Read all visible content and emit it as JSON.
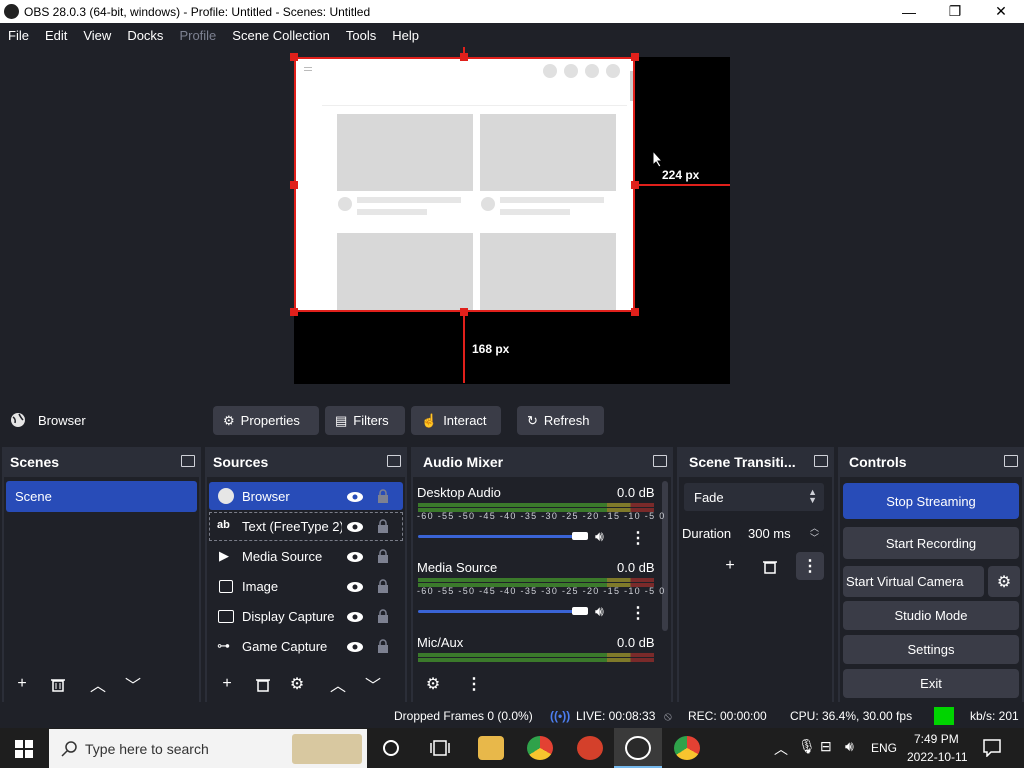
{
  "window": {
    "title": "OBS 28.0.3 (64-bit, windows) - Profile: Untitled - Scenes: Untitled",
    "minimize_glyph": "—",
    "maximize_glyph": "❐",
    "close_glyph": "✕"
  },
  "menu": [
    "File",
    "Edit",
    "View",
    "Docks",
    "Profile",
    "Scene Collection",
    "Tools",
    "Help"
  ],
  "preview": {
    "width_label": "224 px",
    "height_label": "168 px"
  },
  "context_bar": {
    "source_name": "Browser",
    "properties": "Properties",
    "filters": "Filters",
    "interact": "Interact",
    "refresh": "Refresh"
  },
  "scenes": {
    "title": "Scenes",
    "items": [
      "Scene"
    ]
  },
  "sources": {
    "title": "Sources",
    "items": [
      {
        "label": "Browser",
        "icon": "globe-icon"
      },
      {
        "label": "Text (FreeType 2)",
        "icon": "text-icon"
      },
      {
        "label": "Media Source",
        "icon": "play-icon"
      },
      {
        "label": "Image",
        "icon": "image-icon"
      },
      {
        "label": "Display Capture",
        "icon": "monitor-icon"
      },
      {
        "label": "Game Capture",
        "icon": "gamepad-icon"
      }
    ]
  },
  "audio_mixer": {
    "title": "Audio Mixer",
    "ticks": "-60 -55 -50 -45 -40 -35 -30 -25 -20 -15 -10 -5 0",
    "channels": [
      {
        "name": "Desktop Audio",
        "level": "0.0 dB"
      },
      {
        "name": "Media Source",
        "level": "0.0 dB"
      },
      {
        "name": "Mic/Aux",
        "level": "0.0 dB"
      }
    ]
  },
  "transitions": {
    "title": "Scene Transiti...",
    "selected": "Fade",
    "duration_label": "Duration",
    "duration_value": "300 ms"
  },
  "controls": {
    "title": "Controls",
    "stop_streaming": "Stop Streaming",
    "start_recording": "Start Recording",
    "start_virtual_camera": "Start Virtual Camera",
    "studio_mode": "Studio Mode",
    "settings": "Settings",
    "exit": "Exit"
  },
  "status": {
    "dropped_frames": "Dropped Frames 0 (0.0%)",
    "live": "LIVE: 00:08:33",
    "rec": "REC: 00:00:00",
    "cpu": "CPU: 36.4%, 30.00 fps",
    "kbps": "kb/s: 201"
  },
  "taskbar": {
    "search_placeholder": "Type here to search",
    "language": "ENG",
    "time": "7:49 PM",
    "date": "2022-10-11"
  },
  "colors": {
    "accent": "#284cb8",
    "selection_outline": "#e0201b",
    "stream_indicator": "#00d400"
  }
}
